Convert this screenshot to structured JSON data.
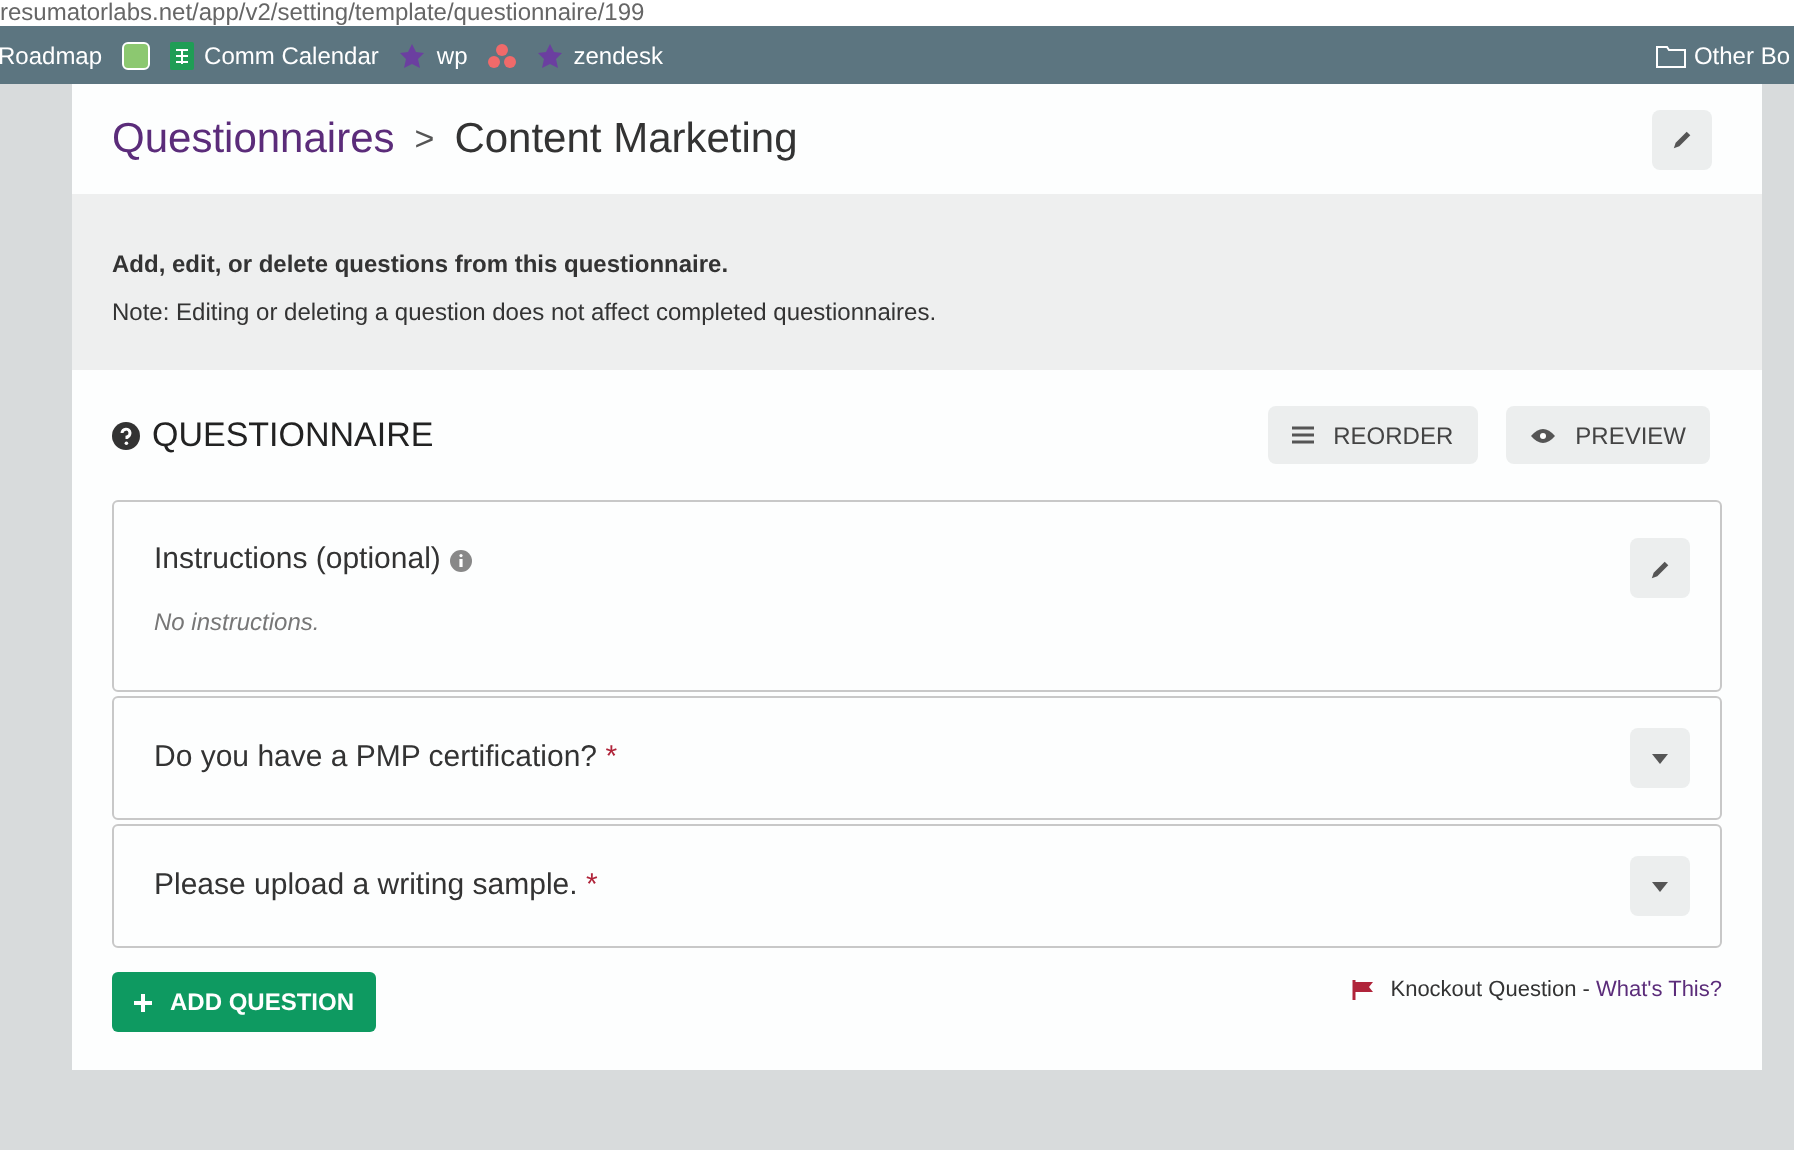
{
  "browser": {
    "url": "resumatorlabs.net/app/v2/setting/template/questionnaire/199",
    "bookmarks": [
      {
        "kind": "text",
        "label": "Roadmap"
      },
      {
        "kind": "app"
      },
      {
        "kind": "sheet",
        "label": "Comm Calendar"
      },
      {
        "kind": "star",
        "label": "wp"
      },
      {
        "kind": "dots"
      },
      {
        "kind": "star",
        "label": "zendesk"
      }
    ],
    "other_bookmarks": "Other Bo"
  },
  "breadcrumb": {
    "parent": "Questionnaires",
    "separator": ">",
    "current": "Content Marketing"
  },
  "notice": {
    "title": "Add, edit, or delete questions from this questionnaire.",
    "note": "Note: Editing or deleting a question does not affect completed questionnaires."
  },
  "section": {
    "title": "QUESTIONNAIRE",
    "buttons": [
      {
        "kind": "reorder",
        "label": "REORDER"
      },
      {
        "kind": "preview",
        "label": "PREVIEW"
      }
    ]
  },
  "instructions": {
    "title": "Instructions (optional)",
    "text": "No instructions."
  },
  "questions": [
    {
      "text": "Do you have a PMP certification?",
      "required": true,
      "required_mark": "*"
    },
    {
      "text": "Please upload a writing sample.",
      "required": true,
      "required_mark": "*"
    }
  ],
  "add_button": "ADD QUESTION",
  "legend": {
    "label": "Knockout Question -",
    "link": "What's This?"
  }
}
